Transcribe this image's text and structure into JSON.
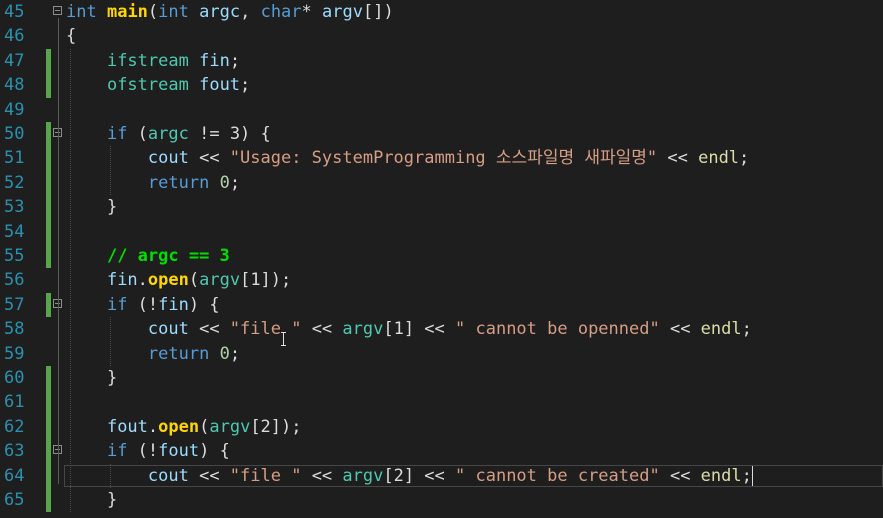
{
  "editor": {
    "lines": [
      {
        "num": "45",
        "tokens": [
          [
            "kw",
            "int"
          ],
          [
            "plain",
            " "
          ],
          [
            "fnb",
            "main"
          ],
          [
            "plain",
            "("
          ],
          [
            "kw",
            "int"
          ],
          [
            "plain",
            " "
          ],
          [
            "var",
            "argc"
          ],
          [
            "plain",
            ", "
          ],
          [
            "kw",
            "char"
          ],
          [
            "plain",
            "* "
          ],
          [
            "var",
            "argv"
          ],
          [
            "plain",
            "[])"
          ]
        ]
      },
      {
        "num": "46",
        "tokens": [
          [
            "plain",
            "{"
          ]
        ]
      },
      {
        "num": "47",
        "tokens": [
          [
            "plain",
            "    "
          ],
          [
            "ty",
            "ifstream"
          ],
          [
            "plain",
            " "
          ],
          [
            "lightblue",
            "fin"
          ],
          [
            "plain",
            ";"
          ]
        ]
      },
      {
        "num": "48",
        "tokens": [
          [
            "plain",
            "    "
          ],
          [
            "ty",
            "ofstream"
          ],
          [
            "plain",
            " "
          ],
          [
            "lightblue",
            "fout"
          ],
          [
            "plain",
            ";"
          ]
        ]
      },
      {
        "num": "49",
        "tokens": []
      },
      {
        "num": "50",
        "tokens": [
          [
            "plain",
            "    "
          ],
          [
            "kw",
            "if"
          ],
          [
            "plain",
            " ("
          ],
          [
            "param",
            "argc"
          ],
          [
            "plain",
            " != 3) {"
          ]
        ]
      },
      {
        "num": "51",
        "tokens": [
          [
            "plain",
            "        "
          ],
          [
            "lightblue",
            "cout"
          ],
          [
            "plain",
            " << "
          ],
          [
            "str",
            "\"Usage: SystemProgramming 소스파일명 새파일명\""
          ],
          [
            "plain",
            " << "
          ],
          [
            "fn",
            "endl"
          ],
          [
            "plain",
            ";"
          ]
        ]
      },
      {
        "num": "52",
        "tokens": [
          [
            "plain",
            "        "
          ],
          [
            "kw",
            "return"
          ],
          [
            "plain",
            " "
          ],
          [
            "num",
            "0"
          ],
          [
            "plain",
            ";"
          ]
        ]
      },
      {
        "num": "53",
        "tokens": [
          [
            "plain",
            "    }"
          ]
        ]
      },
      {
        "num": "54",
        "tokens": []
      },
      {
        "num": "55",
        "tokens": [
          [
            "plain",
            "    "
          ],
          [
            "cmt",
            "// argc == 3"
          ]
        ]
      },
      {
        "num": "56",
        "tokens": [
          [
            "plain",
            "    "
          ],
          [
            "lightblue",
            "fin"
          ],
          [
            "plain",
            "."
          ],
          [
            "fnb",
            "open"
          ],
          [
            "plain",
            "("
          ],
          [
            "param",
            "argv"
          ],
          [
            "plain",
            "[1]);"
          ]
        ]
      },
      {
        "num": "57",
        "tokens": [
          [
            "plain",
            "    "
          ],
          [
            "kw",
            "if"
          ],
          [
            "plain",
            " (!"
          ],
          [
            "lightblue",
            "fin"
          ],
          [
            "plain",
            ") {"
          ]
        ]
      },
      {
        "num": "58",
        "tokens": [
          [
            "plain",
            "        "
          ],
          [
            "lightblue",
            "cout"
          ],
          [
            "plain",
            " << "
          ],
          [
            "str",
            "\"file \""
          ],
          [
            "plain",
            " << "
          ],
          [
            "param",
            "argv"
          ],
          [
            "plain",
            "[1] << "
          ],
          [
            "str",
            "\" cannot be openned\""
          ],
          [
            "plain",
            " << "
          ],
          [
            "fn",
            "endl"
          ],
          [
            "plain",
            ";"
          ]
        ]
      },
      {
        "num": "59",
        "tokens": [
          [
            "plain",
            "        "
          ],
          [
            "kw",
            "return"
          ],
          [
            "plain",
            " "
          ],
          [
            "num",
            "0"
          ],
          [
            "plain",
            ";"
          ]
        ]
      },
      {
        "num": "60",
        "tokens": [
          [
            "plain",
            "    }"
          ]
        ]
      },
      {
        "num": "61",
        "tokens": []
      },
      {
        "num": "62",
        "tokens": [
          [
            "plain",
            "    "
          ],
          [
            "lightblue",
            "fout"
          ],
          [
            "plain",
            "."
          ],
          [
            "fnb",
            "open"
          ],
          [
            "plain",
            "("
          ],
          [
            "param",
            "argv"
          ],
          [
            "plain",
            "[2]);"
          ]
        ]
      },
      {
        "num": "63",
        "tokens": [
          [
            "plain",
            "    "
          ],
          [
            "kw",
            "if"
          ],
          [
            "plain",
            " (!"
          ],
          [
            "lightblue",
            "fout"
          ],
          [
            "plain",
            ") {"
          ]
        ]
      },
      {
        "num": "64",
        "tokens": [
          [
            "plain",
            "        "
          ],
          [
            "lightblue",
            "cout"
          ],
          [
            "plain",
            " << "
          ],
          [
            "str",
            "\"file \""
          ],
          [
            "plain",
            " << "
          ],
          [
            "param",
            "argv"
          ],
          [
            "plain",
            "[2] << "
          ],
          [
            "str",
            "\" cannot be created\""
          ],
          [
            "plain",
            " << "
          ],
          [
            "fn",
            "endl"
          ],
          [
            "plain",
            ";"
          ]
        ]
      },
      {
        "num": "65",
        "tokens": [
          [
            "plain",
            "    }"
          ]
        ]
      }
    ],
    "changed_lines": [
      "47",
      "48",
      "50",
      "51",
      "52",
      "53",
      "54",
      "55",
      "57",
      "60",
      "61",
      "62",
      "63",
      "64",
      "65"
    ],
    "fold_lines": [
      "45",
      "50",
      "57",
      "63"
    ],
    "current_line": "64"
  }
}
